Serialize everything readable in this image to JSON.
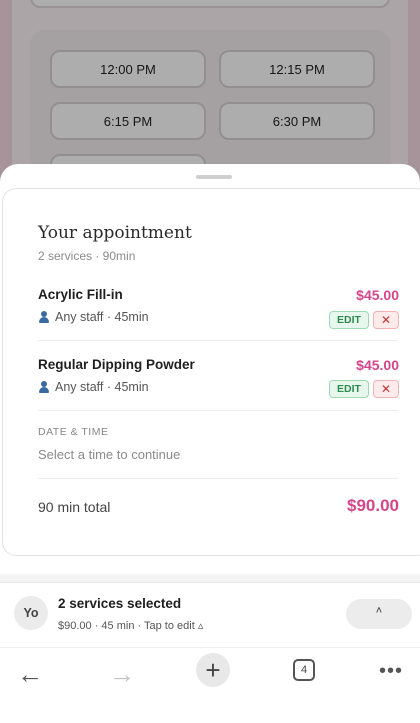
{
  "background": {
    "time_slots": [
      "12:00 PM",
      "12:15 PM",
      "6:15 PM",
      "6:30 PM"
    ]
  },
  "appointment": {
    "title": "Your appointment",
    "summary": "2 services · 90min",
    "services": [
      {
        "name": "Acrylic Fill-in",
        "price": "$45.00",
        "staff": "Any staff · 45min",
        "edit_label": "EDIT",
        "remove_label": "✕"
      },
      {
        "name": "Regular Dipping Powder",
        "price": "$45.00",
        "staff": "Any staff · 45min",
        "edit_label": "EDIT",
        "remove_label": "✕"
      }
    ],
    "date_time_label": "DATE & TIME",
    "date_time_value": "Select a time to continue",
    "total_label": "90 min total",
    "total_value": "$90.00"
  },
  "selection_bar": {
    "avatar_text": "Yo",
    "title": "2 services selected",
    "subtitle": "$90.00 · 45 min · Tap to edit ▵",
    "expand_glyph": "˄"
  },
  "nav": {
    "back_glyph": "←",
    "forward_glyph": "→",
    "add_glyph": "+",
    "tab_count": "4",
    "more_glyph": "•••"
  },
  "colors": {
    "accent_pink": "#d6458a",
    "edit_green": "#2d8b4f",
    "remove_red": "#cc3333"
  }
}
